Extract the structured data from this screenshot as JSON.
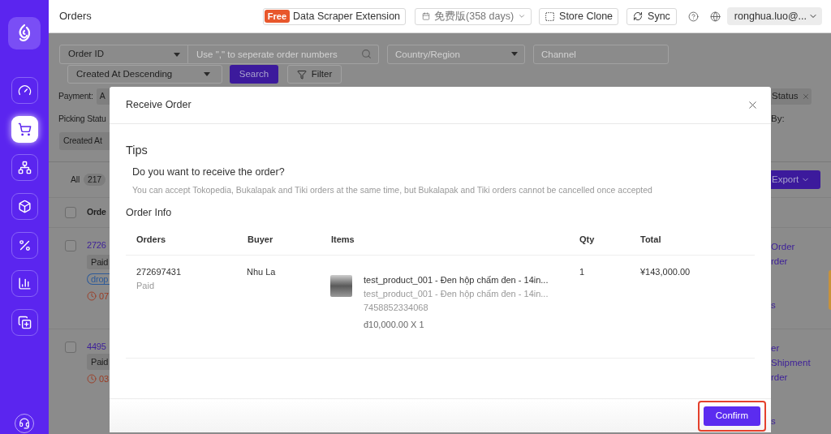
{
  "sidebar": {
    "items": [
      {
        "selected": false
      },
      {
        "selected": true
      },
      {
        "selected": false
      },
      {
        "selected": false
      },
      {
        "selected": false
      },
      {
        "selected": false
      },
      {
        "selected": false
      }
    ]
  },
  "top_bar": {
    "title": "Orders",
    "extension": {
      "badge": "Free",
      "label": "Data Scraper Extension"
    },
    "plan": "免费版(358 days)",
    "store_clone": "Store Clone",
    "sync": "Sync",
    "account": "ronghua.luo@..."
  },
  "filters": {
    "search_type": "Order ID",
    "order_numbers": {
      "placeholder": "Use \",\" to seperate order numbers"
    },
    "country": {
      "placeholder": "Country/Region"
    },
    "channel": {
      "placeholder": "Channel"
    },
    "sort": "Created At Descending",
    "search_button": "Search",
    "filter_button": "Filter"
  },
  "filter_tags": {
    "payment_label": "Payment:",
    "payment_chip": "A",
    "picking_label": "Picking Statu",
    "created_chip": "Created At",
    "status_chip": "Status",
    "by_label": "By:"
  },
  "tabs": [
    {
      "label": "All",
      "count": "217"
    }
  ],
  "export_button": "Export",
  "orders_table": {
    "header": {
      "checked": false,
      "column_1": "Orde"
    },
    "rows": [
      {
        "checked": false,
        "order": "2726",
        "status": "Paid",
        "tag": "drop",
        "time": "07",
        "actions": [
          "Order",
          "rder",
          "s"
        ]
      },
      {
        "checked": false,
        "order": "4495",
        "status": "Paid",
        "time": "03",
        "actions": [
          "er",
          "Shipment",
          "rder",
          "s"
        ]
      }
    ]
  },
  "modal": {
    "title": "Receive Order",
    "tips_heading": "Tips",
    "question": "Do you want to receive the order?",
    "note": "You can accept Tokopedia, Bukalapak and Tiki orders at the same time, but Bukalapak and Tiki orders cannot be cancelled once accepted",
    "section": "Order Info",
    "table": {
      "columns": [
        "Orders",
        "Buyer",
        "Items",
        "Qty",
        "Total"
      ],
      "rows": [
        {
          "order": "272697431",
          "status": "Paid",
          "buyer": "Nhu La",
          "item": {
            "title": "test_product_001 - Đen hộp chấm đen - 14in...",
            "subtitle": "test_product_001 - Đen hộp chấm đen - 14in...",
            "sku": "7458852334068",
            "price": "đ10,000.00 X 1"
          },
          "qty": "1",
          "total": "¥143,000.00"
        }
      ]
    },
    "confirm": {
      "label": "Confirm",
      "highlighted": true
    }
  }
}
